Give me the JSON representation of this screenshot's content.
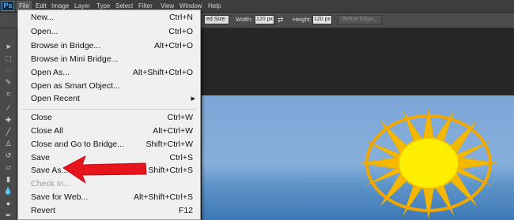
{
  "menubar": {
    "logo": "Ps",
    "items": [
      "File",
      "Edit",
      "Image",
      "Layer",
      "Type",
      "Select",
      "Filter",
      "View",
      "Window",
      "Help"
    ]
  },
  "options_bar": {
    "style_value": "ed Size",
    "width_label": "Width:",
    "width_value": "120 px",
    "height_label": "Height:",
    "height_value": "120 px",
    "refine_label": "Refine Edge..."
  },
  "file_menu": {
    "items": [
      {
        "label": "New...",
        "shortcut": "Ctrl+N"
      },
      {
        "label": "Open...",
        "shortcut": "Ctrl+O"
      },
      {
        "label": "Browse in Bridge...",
        "shortcut": "Alt+Ctrl+O"
      },
      {
        "label": "Browse in Mini Bridge...",
        "shortcut": ""
      },
      {
        "label": "Open As...",
        "shortcut": "Alt+Shift+Ctrl+O"
      },
      {
        "label": "Open as Smart Object...",
        "shortcut": ""
      },
      {
        "label": "Open Recent",
        "shortcut": ""
      },
      {
        "label": "Close",
        "shortcut": "Ctrl+W"
      },
      {
        "label": "Close All",
        "shortcut": "Alt+Ctrl+W"
      },
      {
        "label": "Close and Go to Bridge...",
        "shortcut": "Shift+Ctrl+W"
      },
      {
        "label": "Save",
        "shortcut": "Ctrl+S"
      },
      {
        "label": "Save As...",
        "shortcut": "Shift+Ctrl+S"
      },
      {
        "label": "Check In...",
        "shortcut": ""
      },
      {
        "label": "Save for Web...",
        "shortcut": "Alt+Shift+Ctrl+S"
      },
      {
        "label": "Revert",
        "shortcut": "F12"
      }
    ]
  },
  "colors": {
    "annotation_arrow": "#e8141c",
    "sun_core": "#ffee00",
    "sun_ray": "#f5b800"
  }
}
